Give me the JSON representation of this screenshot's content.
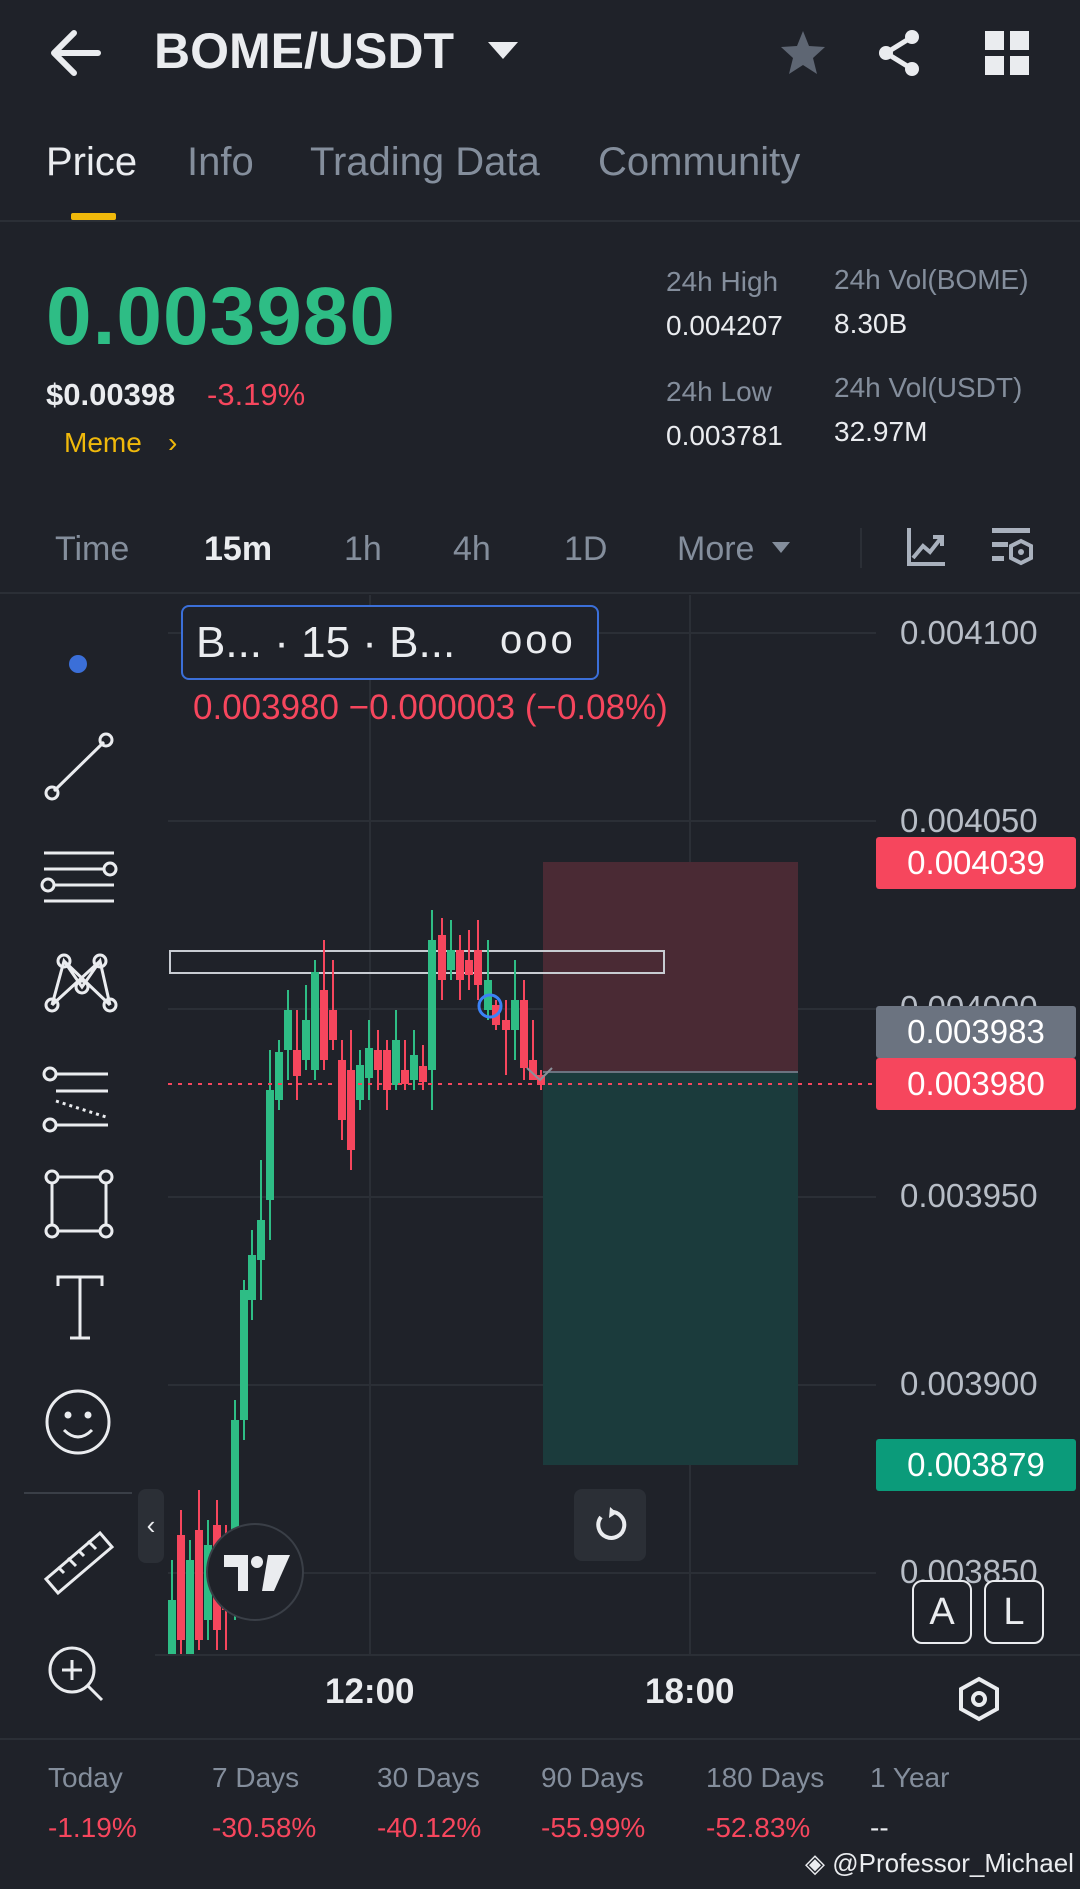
{
  "header": {
    "pair": "BOME/USDT"
  },
  "tabs": [
    {
      "label": "Price",
      "active": true
    },
    {
      "label": "Info",
      "active": false
    },
    {
      "label": "Trading Data",
      "active": false
    },
    {
      "label": "Community",
      "active": false
    }
  ],
  "price": {
    "last": "0.003980",
    "usd": "$0.00398",
    "change_pct": "-3.19%",
    "tag": "Meme"
  },
  "stats": {
    "high_label": "24h High",
    "high_value": "0.004207",
    "low_label": "24h Low",
    "low_value": "0.003781",
    "vol_base_label": "24h Vol(BOME)",
    "vol_base_value": "8.30B",
    "vol_quote_label": "24h Vol(USDT)",
    "vol_quote_value": "32.97M"
  },
  "intervals": [
    {
      "label": "Time",
      "active": false
    },
    {
      "label": "15m",
      "active": true
    },
    {
      "label": "1h",
      "active": false
    },
    {
      "label": "4h",
      "active": false
    },
    {
      "label": "1D",
      "active": false
    },
    {
      "label": "More",
      "active": false
    }
  ],
  "chart": {
    "legend_text": "B... · 15 · B...",
    "legend_dots": "ooo",
    "ohlc_text": "0.003980  −0.000003 (−0.08%)",
    "price_axis": [
      "0.004100",
      "0.004050",
      "0.004000",
      "0.003950",
      "0.003900",
      "0.003850"
    ],
    "badges": {
      "stop": "0.004039",
      "entry": "0.003983",
      "current": "0.003980",
      "target": "0.003879"
    },
    "time_axis": [
      "12:00",
      "18:00"
    ],
    "btn_a": "A",
    "btn_l": "L",
    "collapse_glyph": "‹",
    "colors": {
      "up": "#2ebd85",
      "down": "#f6465d",
      "stop_zone": "#4a2a34",
      "target_zone": "#1b3b3c"
    }
  },
  "performance": [
    {
      "label": "Today",
      "value": "-1.19%"
    },
    {
      "label": "7 Days",
      "value": "-30.58%"
    },
    {
      "label": "30 Days",
      "value": "-40.12%"
    },
    {
      "label": "90 Days",
      "value": "-55.99%"
    },
    {
      "label": "180 Days",
      "value": "-52.83%"
    },
    {
      "label": "1 Year",
      "value": "--"
    }
  ],
  "watermark": "@Professor_Michael",
  "icons": {
    "back": "arrow-left-icon",
    "dropdown": "caret-down-icon",
    "favorite": "star-icon",
    "share": "share-icon",
    "grid": "grid-icon",
    "indicator": "chart-indicator-icon",
    "settings": "chart-settings-icon",
    "reset": "refresh-icon",
    "hexagon": "hexagon-settings-icon"
  }
}
